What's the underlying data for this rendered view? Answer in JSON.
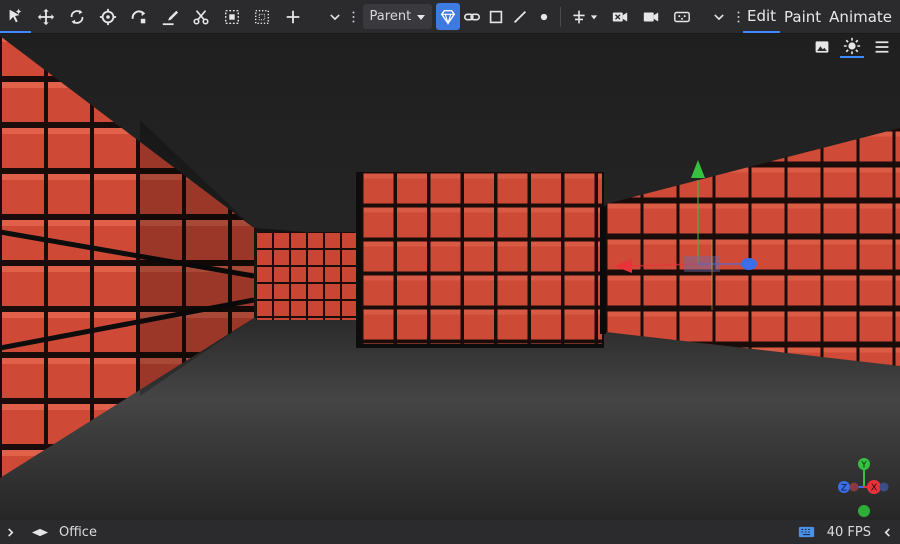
{
  "toolbar": {
    "parent_label": "Parent",
    "mode_tabs": [
      {
        "label": "Edit",
        "active": true
      },
      {
        "label": "Paint",
        "active": false
      },
      {
        "label": "Animate",
        "active": false
      }
    ]
  },
  "statusbar": {
    "scene_name": "Office",
    "fps": "40 FPS"
  },
  "gizmo": {
    "axes": [
      "Y",
      "X",
      "Z"
    ],
    "colors": {
      "x": "#e8333b",
      "y": "#36c13e",
      "z": "#3b6ee8"
    }
  },
  "colors": {
    "accent": "#3d8bff",
    "brick": "#cf4a36",
    "toolbar_bg": "#2b2b2e"
  }
}
